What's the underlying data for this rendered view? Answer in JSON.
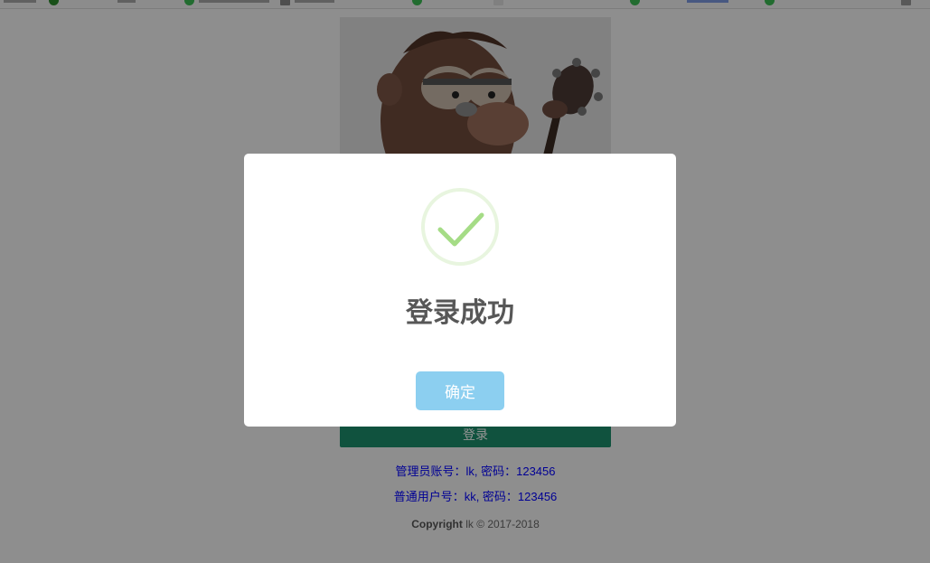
{
  "login_page": {
    "login_button_label": "登录",
    "admin_hint": "管理员账号：lk, 密码：123456",
    "user_hint": "普通用户号：kk, 密码：123456",
    "copyright_label": "Copyright",
    "copyright_rest": " lk © 2017-2018"
  },
  "dialog": {
    "title": "登录成功",
    "confirm_label": "确定",
    "icon": "check-icon",
    "accent_color": "#a5dc86",
    "button_color": "#8ccff0"
  },
  "colors": {
    "login_button": "#1d8e6b",
    "hint_text": "#0000ff"
  }
}
